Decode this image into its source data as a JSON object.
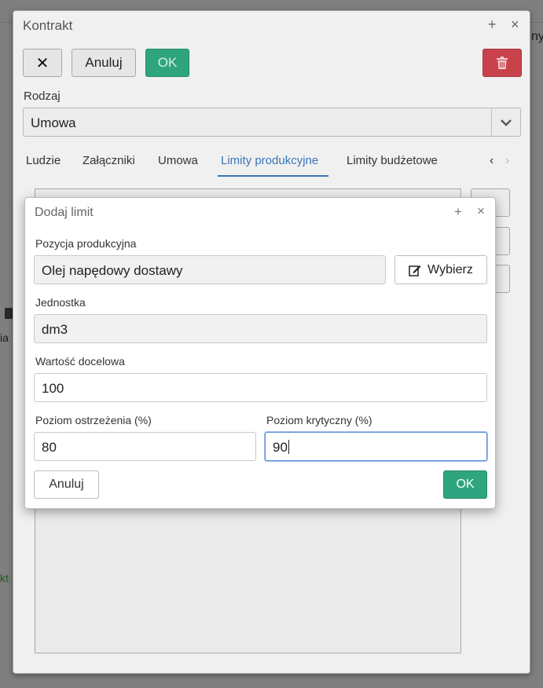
{
  "background": {
    "right_label": "ny",
    "left_label_1": "ia",
    "left_label_2": "kt"
  },
  "outer_dialog": {
    "title": "Kontrakt",
    "plus": "+",
    "close": "×",
    "toolbar": {
      "close_button": "✕",
      "cancel_label": "Anuluj",
      "ok_label": "OK",
      "delete_icon": "trash-icon"
    },
    "rodzaj": {
      "label": "Rodzaj",
      "value": "Umowa"
    },
    "tabs": [
      {
        "label": "Ludzie",
        "active": false
      },
      {
        "label": "Załączniki",
        "active": false
      },
      {
        "label": "Umowa",
        "active": false
      },
      {
        "label": "Limity produkcyjne",
        "active": true
      },
      {
        "label": "Limity budżetowe",
        "active": false
      }
    ],
    "tab_prev": "‹",
    "tab_next": "›"
  },
  "modal": {
    "title": "Dodaj limit",
    "plus": "+",
    "close": "×",
    "pozycja": {
      "label": "Pozycja produkcyjna",
      "value": "Olej napędowy dostawy",
      "select_button": "Wybierz"
    },
    "jednostka": {
      "label": "Jednostka",
      "value": "dm3"
    },
    "wartosc": {
      "label": "Wartość docelowa",
      "value": "100"
    },
    "ostrzezenie": {
      "label": "Poziom ostrzeżenia (%)",
      "value": "80"
    },
    "krytyczny": {
      "label": "Poziom krytyczny (%)",
      "value": "90"
    },
    "cancel_label": "Anuluj",
    "ok_label": "OK"
  },
  "colors": {
    "accent_blue": "#3a74b8",
    "ok_green": "#2ea57f",
    "danger_red": "#c8424c"
  }
}
